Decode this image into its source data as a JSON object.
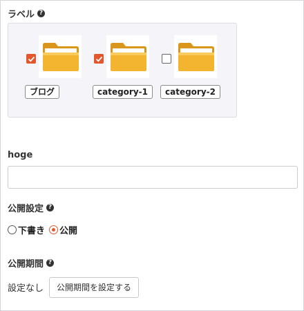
{
  "label_section": {
    "title": "ラベル",
    "categories": [
      {
        "label": "ブログ",
        "checked": true,
        "icon": "folder-icon"
      },
      {
        "label": "category-1",
        "checked": true,
        "icon": "folder-icon"
      },
      {
        "label": "category-2",
        "checked": false,
        "icon": "folder-icon"
      }
    ]
  },
  "hoge_field": {
    "label": "hoge",
    "value": ""
  },
  "publish_setting": {
    "title": "公開設定",
    "options": [
      {
        "label": "下書き",
        "selected": false
      },
      {
        "label": "公開",
        "selected": true
      }
    ]
  },
  "publish_period": {
    "title": "公開期間",
    "status": "設定なし",
    "button_label": "公開期間を設定する"
  },
  "colors": {
    "accent": "#e4572e",
    "panel": "#f5f4f8",
    "folder": "#f0b429"
  }
}
